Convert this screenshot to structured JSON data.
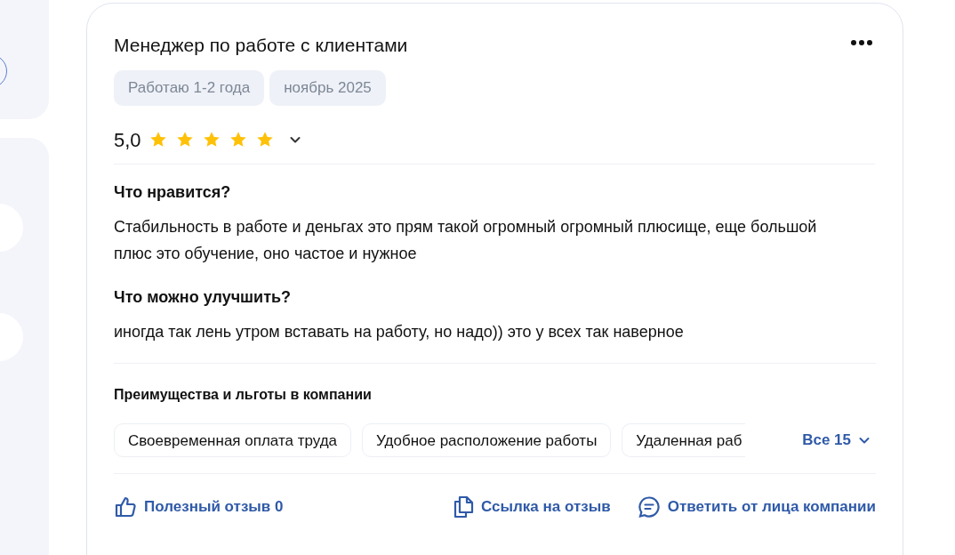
{
  "review": {
    "title": "Менеджер по работе с клиентами",
    "tags": [
      "Работаю 1-2 года",
      "ноябрь 2025"
    ],
    "rating": "5,0",
    "stars": 5,
    "sections": [
      {
        "heading": "Что нравится?",
        "text": "Стабильность в работе и деньгах это прям такой огромный огромный плюсище, еще большой плюс это обучение, оно частое и нужное"
      },
      {
        "heading": "Что можно улучшить?",
        "text": "иногда так лень утром вставать на работу, но надо)) это у всех так наверное"
      }
    ],
    "benefits": {
      "heading": "Преимущества и льготы в компании",
      "items": [
        "Своевременная оплата труда",
        "Удобное расположение работы",
        "Удаленная раб"
      ],
      "more": "Все 15"
    },
    "actions": [
      {
        "kind": "like",
        "label": "Полезный отзыв 0"
      },
      {
        "kind": "link",
        "label": "Ссылка на отзыв"
      },
      {
        "kind": "reply",
        "label": "Ответить от лица компании"
      }
    ]
  }
}
